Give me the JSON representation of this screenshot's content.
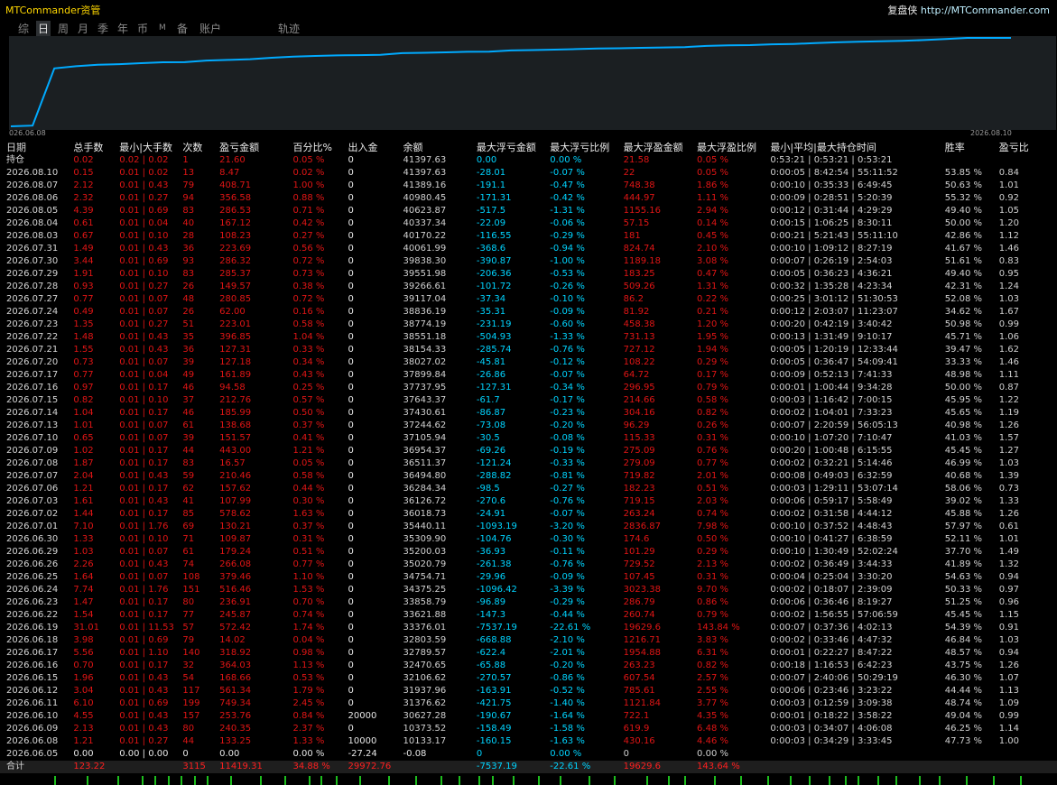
{
  "header": {
    "app_title": "MTCommander资管",
    "link_label": "复盘侠",
    "link_url": "http://MTCommander.com"
  },
  "tabs": [
    "综",
    "日",
    "周",
    "月",
    "季",
    "年",
    "币",
    "M",
    "备",
    "账户",
    "轨迹"
  ],
  "active_tab": "日",
  "chart_data": {
    "type": "line",
    "x_start_label": "026.06.08",
    "x_end_label": "2026.08.10",
    "series_color": "#00aaff",
    "grid": false,
    "y": [
      -27.24,
      10133.17,
      10373.52,
      30627.28,
      31376.62,
      31937.96,
      32106.62,
      32470.65,
      32789.57,
      32803.59,
      33376.01,
      33621.88,
      33858.79,
      34375.25,
      34754.71,
      35020.79,
      35200.03,
      35309.9,
      35440.11,
      36018.73,
      36126.72,
      36284.34,
      36494.8,
      36511.37,
      36954.37,
      37105.94,
      37244.62,
      37430.61,
      37643.37,
      37737.95,
      37899.84,
      38027.02,
      38154.33,
      38551.18,
      38774.19,
      38836.19,
      39117.04,
      39266.61,
      39551.98,
      39838.3,
      40061.99,
      40170.22,
      40337.34,
      40623.87,
      40980.45,
      41389.16,
      41397.63,
      41397.63
    ]
  },
  "columns": [
    "日期",
    "总手数",
    "最小|大手数",
    "次数",
    "盈亏金额",
    "百分比%",
    "出入金",
    "余额",
    "最大浮亏金额",
    "最大浮亏比例",
    "最大浮盈金额",
    "最大浮盈比例",
    "最小|平均|最大持仓时间",
    "胜率",
    "盈亏比"
  ],
  "rows": [
    [
      "持仓",
      "0.02",
      "0.02 | 0.02",
      "1",
      "21.60",
      "0.05 %",
      "0",
      "41397.63",
      "0.00",
      "0.00 %",
      "21.58",
      "0.05 %",
      "0:53:21 | 0:53:21 | 0:53:21",
      "",
      ""
    ],
    [
      "2026.08.10",
      "0.15",
      "0.01 | 0.02",
      "13",
      "8.47",
      "0.02 %",
      "0",
      "41397.63",
      "-28.01",
      "-0.07 %",
      "22",
      "0.05 %",
      "0:00:05 | 8:42:54 | 55:11:52",
      "53.85 %",
      "0.84"
    ],
    [
      "2026.08.07",
      "2.12",
      "0.01 | 0.43",
      "79",
      "408.71",
      "1.00 %",
      "0",
      "41389.16",
      "-191.1",
      "-0.47 %",
      "748.38",
      "1.86 %",
      "0:00:10 | 0:35:33 | 6:49:45",
      "50.63 %",
      "1.01"
    ],
    [
      "2026.08.06",
      "2.32",
      "0.01 | 0.27",
      "94",
      "356.58",
      "0.88 %",
      "0",
      "40980.45",
      "-171.31",
      "-0.42 %",
      "444.97",
      "1.11 %",
      "0:00:09 | 0:28:51 | 5:20:39",
      "55.32 %",
      "0.92"
    ],
    [
      "2026.08.05",
      "4.39",
      "0.01 | 0.69",
      "83",
      "286.53",
      "0.71 %",
      "0",
      "40623.87",
      "-517.5",
      "-1.31 %",
      "1155.16",
      "2.94 %",
      "0:00:12 | 0:31:44 | 4:29:29",
      "49.40 %",
      "1.05"
    ],
    [
      "2026.08.04",
      "0.61",
      "0.01 | 0.04",
      "40",
      "167.12",
      "0.42 %",
      "0",
      "40337.34",
      "-22.09",
      "-0.06 %",
      "57.15",
      "0.14 %",
      "0:00:15 | 1:06:25 | 8:30:11",
      "50.00 %",
      "1.20"
    ],
    [
      "2026.08.03",
      "0.67",
      "0.01 | 0.10",
      "28",
      "108.23",
      "0.27 %",
      "0",
      "40170.22",
      "-116.55",
      "-0.29 %",
      "181",
      "0.45 %",
      "0:00:21 | 5:21:43 | 55:11:10",
      "42.86 %",
      "1.12"
    ],
    [
      "2026.07.31",
      "1.49",
      "0.01 | 0.43",
      "36",
      "223.69",
      "0.56 %",
      "0",
      "40061.99",
      "-368.6",
      "-0.94 %",
      "824.74",
      "2.10 %",
      "0:00:10 | 1:09:12 | 8:27:19",
      "41.67 %",
      "1.46"
    ],
    [
      "2026.07.30",
      "3.44",
      "0.01 | 0.69",
      "93",
      "286.32",
      "0.72 %",
      "0",
      "39838.30",
      "-390.87",
      "-1.00 %",
      "1189.18",
      "3.08 %",
      "0:00:07 | 0:26:19 | 2:54:03",
      "51.61 %",
      "0.83"
    ],
    [
      "2026.07.29",
      "1.91",
      "0.01 | 0.10",
      "83",
      "285.37",
      "0.73 %",
      "0",
      "39551.98",
      "-206.36",
      "-0.53 %",
      "183.25",
      "0.47 %",
      "0:00:05 | 0:36:23 | 4:36:21",
      "49.40 %",
      "0.95"
    ],
    [
      "2026.07.28",
      "0.93",
      "0.01 | 0.27",
      "26",
      "149.57",
      "0.38 %",
      "0",
      "39266.61",
      "-101.72",
      "-0.26 %",
      "509.26",
      "1.31 %",
      "0:00:32 | 1:35:28 | 4:23:34",
      "42.31 %",
      "1.24"
    ],
    [
      "2026.07.27",
      "0.77",
      "0.01 | 0.07",
      "48",
      "280.85",
      "0.72 %",
      "0",
      "39117.04",
      "-37.34",
      "-0.10 %",
      "86.2",
      "0.22 %",
      "0:00:25 | 3:01:12 | 51:30:53",
      "52.08 %",
      "1.03"
    ],
    [
      "2026.07.24",
      "0.49",
      "0.01 | 0.07",
      "26",
      "62.00",
      "0.16 %",
      "0",
      "38836.19",
      "-35.31",
      "-0.09 %",
      "81.92",
      "0.21 %",
      "0:00:12 | 2:03:07 | 11:23:07",
      "34.62 %",
      "1.67"
    ],
    [
      "2026.07.23",
      "1.35",
      "0.01 | 0.27",
      "51",
      "223.01",
      "0.58 %",
      "0",
      "38774.19",
      "-231.19",
      "-0.60 %",
      "458.38",
      "1.20 %",
      "0:00:20 | 0:42:19 | 3:40:42",
      "50.98 %",
      "0.99"
    ],
    [
      "2026.07.22",
      "1.48",
      "0.01 | 0.43",
      "35",
      "396.85",
      "1.04 %",
      "0",
      "38551.18",
      "-504.93",
      "-1.33 %",
      "731.13",
      "1.95 %",
      "0:00:13 | 1:31:49 | 9:10:17",
      "45.71 %",
      "1.06"
    ],
    [
      "2026.07.21",
      "1.55",
      "0.01 | 0.43",
      "36",
      "127.31",
      "0.33 %",
      "0",
      "38154.33",
      "-285.74",
      "-0.76 %",
      "727.12",
      "1.94 %",
      "0:00:05 | 1:20:19 | 12:33:44",
      "39.47 %",
      "1.62"
    ],
    [
      "2026.07.20",
      "0.73",
      "0.01 | 0.07",
      "39",
      "127.18",
      "0.34 %",
      "0",
      "38027.02",
      "-45.81",
      "-0.12 %",
      "108.22",
      "0.29 %",
      "0:00:05 | 0:36:47 | 54:09:41",
      "33.33 %",
      "1.46"
    ],
    [
      "2026.07.17",
      "0.77",
      "0.01 | 0.04",
      "49",
      "161.89",
      "0.43 %",
      "0",
      "37899.84",
      "-26.86",
      "-0.07 %",
      "64.72",
      "0.17 %",
      "0:00:09 | 0:52:13 | 7:41:33",
      "48.98 %",
      "1.11"
    ],
    [
      "2026.07.16",
      "0.97",
      "0.01 | 0.17",
      "46",
      "94.58",
      "0.25 %",
      "0",
      "37737.95",
      "-127.31",
      "-0.34 %",
      "296.95",
      "0.79 %",
      "0:00:01 | 1:00:44 | 9:34:28",
      "50.00 %",
      "0.87"
    ],
    [
      "2026.07.15",
      "0.82",
      "0.01 | 0.10",
      "37",
      "212.76",
      "0.57 %",
      "0",
      "37643.37",
      "-61.7",
      "-0.17 %",
      "214.66",
      "0.58 %",
      "0:00:03 | 1:16:42 | 7:00:15",
      "45.95 %",
      "1.22"
    ],
    [
      "2026.07.14",
      "1.04",
      "0.01 | 0.17",
      "46",
      "185.99",
      "0.50 %",
      "0",
      "37430.61",
      "-86.87",
      "-0.23 %",
      "304.16",
      "0.82 %",
      "0:00:02 | 1:04:01 | 7:33:23",
      "45.65 %",
      "1.19"
    ],
    [
      "2026.07.13",
      "1.01",
      "0.01 | 0.07",
      "61",
      "138.68",
      "0.37 %",
      "0",
      "37244.62",
      "-73.08",
      "-0.20 %",
      "96.29",
      "0.26 %",
      "0:00:07 | 2:20:59 | 56:05:13",
      "40.98 %",
      "1.26"
    ],
    [
      "2026.07.10",
      "0.65",
      "0.01 | 0.07",
      "39",
      "151.57",
      "0.41 %",
      "0",
      "37105.94",
      "-30.5",
      "-0.08 %",
      "115.33",
      "0.31 %",
      "0:00:10 | 1:07:20 | 7:10:47",
      "41.03 %",
      "1.57"
    ],
    [
      "2026.07.09",
      "1.02",
      "0.01 | 0.17",
      "44",
      "443.00",
      "1.21 %",
      "0",
      "36954.37",
      "-69.26",
      "-0.19 %",
      "275.09",
      "0.76 %",
      "0:00:20 | 1:00:48 | 6:15:55",
      "45.45 %",
      "1.27"
    ],
    [
      "2026.07.08",
      "1.87",
      "0.01 | 0.17",
      "83",
      "16.57",
      "0.05 %",
      "0",
      "36511.37",
      "-121.24",
      "-0.33 %",
      "279.09",
      "0.77 %",
      "0:00:02 | 0:32:21 | 5:14:46",
      "46.99 %",
      "1.03"
    ],
    [
      "2026.07.07",
      "2.04",
      "0.01 | 0.43",
      "59",
      "210.46",
      "0.58 %",
      "0",
      "36494.80",
      "-288.82",
      "-0.81 %",
      "719.82",
      "2.01 %",
      "0:00:08 | 0:49:03 | 6:32:59",
      "40.68 %",
      "1.39"
    ],
    [
      "2026.07.06",
      "1.21",
      "0.01 | 0.17",
      "62",
      "157.62",
      "0.44 %",
      "0",
      "36284.34",
      "-98.5",
      "-0.27 %",
      "182.23",
      "0.51 %",
      "0:00:03 | 1:29:11 | 53:07:14",
      "58.06 %",
      "0.73"
    ],
    [
      "2026.07.03",
      "1.61",
      "0.01 | 0.43",
      "41",
      "107.99",
      "0.30 %",
      "0",
      "36126.72",
      "-270.6",
      "-0.76 %",
      "719.15",
      "2.03 %",
      "0:00:06 | 0:59:17 | 5:58:49",
      "39.02 %",
      "1.33"
    ],
    [
      "2026.07.02",
      "1.44",
      "0.01 | 0.17",
      "85",
      "578.62",
      "1.63 %",
      "0",
      "36018.73",
      "-24.91",
      "-0.07 %",
      "263.24",
      "0.74 %",
      "0:00:02 | 0:31:58 | 4:44:12",
      "45.88 %",
      "1.26"
    ],
    [
      "2026.07.01",
      "7.10",
      "0.01 | 1.76",
      "69",
      "130.21",
      "0.37 %",
      "0",
      "35440.11",
      "-1093.19",
      "-3.20 %",
      "2836.87",
      "7.98 %",
      "0:00:10 | 0:37:52 | 4:48:43",
      "57.97 %",
      "0.61"
    ],
    [
      "2026.06.30",
      "1.33",
      "0.01 | 0.10",
      "71",
      "109.87",
      "0.31 %",
      "0",
      "35309.90",
      "-104.76",
      "-0.30 %",
      "174.6",
      "0.50 %",
      "0:00:10 | 0:41:27 | 6:38:59",
      "52.11 %",
      "1.01"
    ],
    [
      "2026.06.29",
      "1.03",
      "0.01 | 0.07",
      "61",
      "179.24",
      "0.51 %",
      "0",
      "35200.03",
      "-36.93",
      "-0.11 %",
      "101.29",
      "0.29 %",
      "0:00:10 | 1:30:49 | 52:02:24",
      "37.70 %",
      "1.49"
    ],
    [
      "2026.06.26",
      "2.26",
      "0.01 | 0.43",
      "74",
      "266.08",
      "0.77 %",
      "0",
      "35020.79",
      "-261.38",
      "-0.76 %",
      "729.52",
      "2.13 %",
      "0:00:02 | 0:36:49 | 3:44:33",
      "41.89 %",
      "1.32"
    ],
    [
      "2026.06.25",
      "1.64",
      "0.01 | 0.07",
      "108",
      "379.46",
      "1.10 %",
      "0",
      "34754.71",
      "-29.96",
      "-0.09 %",
      "107.45",
      "0.31 %",
      "0:00:04 | 0:25:04 | 3:30:20",
      "54.63 %",
      "0.94"
    ],
    [
      "2026.06.24",
      "7.74",
      "0.01 | 1.76",
      "151",
      "516.46",
      "1.53 %",
      "0",
      "34375.25",
      "-1096.42",
      "-3.39 %",
      "3023.38",
      "9.70 %",
      "0:00:02 | 0:18:07 | 2:39:09",
      "50.33 %",
      "0.97"
    ],
    [
      "2026.06.23",
      "1.47",
      "0.01 | 0.17",
      "80",
      "236.91",
      "0.70 %",
      "0",
      "33858.79",
      "-96.89",
      "-0.29 %",
      "286.79",
      "0.86 %",
      "0:00:06 | 0:36:46 | 8:19:27",
      "51.25 %",
      "0.96"
    ],
    [
      "2026.06.22",
      "1.54",
      "0.01 | 0.17",
      "77",
      "245.87",
      "0.74 %",
      "0",
      "33621.88",
      "-147.3",
      "-0.44 %",
      "260.74",
      "0.79 %",
      "0:00:02 | 1:56:55 | 57:06:59",
      "45.45 %",
      "1.15"
    ],
    [
      "2026.06.19",
      "31.01",
      "0.01 | 11.53",
      "57",
      "572.42",
      "1.74 %",
      "0",
      "33376.01",
      "-7537.19",
      "-22.61 %",
      "19629.6",
      "143.84 %",
      "0:00:07 | 0:37:36 | 4:02:13",
      "54.39 %",
      "0.91"
    ],
    [
      "2026.06.18",
      "3.98",
      "0.01 | 0.69",
      "79",
      "14.02",
      "0.04 %",
      "0",
      "32803.59",
      "-668.88",
      "-2.10 %",
      "1216.71",
      "3.83 %",
      "0:00:02 | 0:33:46 | 4:47:32",
      "46.84 %",
      "1.03"
    ],
    [
      "2026.06.17",
      "5.56",
      "0.01 | 1.10",
      "140",
      "318.92",
      "0.98 %",
      "0",
      "32789.57",
      "-622.4",
      "-2.01 %",
      "1954.88",
      "6.31 %",
      "0:00:01 | 0:22:27 | 8:47:22",
      "48.57 %",
      "0.94"
    ],
    [
      "2026.06.16",
      "0.70",
      "0.01 | 0.17",
      "32",
      "364.03",
      "1.13 %",
      "0",
      "32470.65",
      "-65.88",
      "-0.20 %",
      "263.23",
      "0.82 %",
      "0:00:18 | 1:16:53 | 6:42:23",
      "43.75 %",
      "1.26"
    ],
    [
      "2026.06.15",
      "1.96",
      "0.01 | 0.43",
      "54",
      "168.66",
      "0.53 %",
      "0",
      "32106.62",
      "-270.57",
      "-0.86 %",
      "607.54",
      "2.57 %",
      "0:00:07 | 2:40:06 | 50:29:19",
      "46.30 %",
      "1.07"
    ],
    [
      "2026.06.12",
      "3.04",
      "0.01 | 0.43",
      "117",
      "561.34",
      "1.79 %",
      "0",
      "31937.96",
      "-163.91",
      "-0.52 %",
      "785.61",
      "2.55 %",
      "0:00:06 | 0:23:46 | 3:23:22",
      "44.44 %",
      "1.13"
    ],
    [
      "2026.06.11",
      "6.10",
      "0.01 | 0.69",
      "199",
      "749.34",
      "2.45 %",
      "0",
      "31376.62",
      "-421.75",
      "-1.40 %",
      "1121.84",
      "3.77 %",
      "0:00:03 | 0:12:59 | 3:09:38",
      "48.74 %",
      "1.09"
    ],
    [
      "2026.06.10",
      "4.55",
      "0.01 | 0.43",
      "157",
      "253.76",
      "0.84 %",
      "20000",
      "30627.28",
      "-190.67",
      "-1.64 %",
      "722.1",
      "4.35 %",
      "0:00:01 | 0:18:22 | 3:58:22",
      "49.04 %",
      "0.99"
    ],
    [
      "2026.06.09",
      "2.13",
      "0.01 | 0.43",
      "80",
      "240.35",
      "2.37 %",
      "0",
      "10373.52",
      "-158.49",
      "-1.58 %",
      "619.9",
      "6.48 %",
      "0:00:03 | 0:34:07 | 4:06:08",
      "46.25 %",
      "1.14"
    ],
    [
      "2026.06.08",
      "1.21",
      "0.01 | 0.27",
      "44",
      "133.25",
      "1.33 %",
      "10000",
      "10133.17",
      "-160.15",
      "-1.63 %",
      "430.16",
      "4.46 %",
      "0:00:03 | 0:34:29 | 3:33:45",
      "47.73 %",
      "1.00"
    ],
    [
      "2026.06.05",
      "0.00",
      "0.00 | 0.00",
      "0",
      "0.00",
      "0.00 %",
      "-27.24",
      "-0.08",
      "0",
      "0.00 %",
      "0",
      "0.00 %",
      "",
      "",
      ""
    ]
  ],
  "total": [
    "合计",
    "123.22",
    "",
    "3115",
    "11419.31",
    "34.88 %",
    "29972.76",
    "",
    "-7537.19",
    "-22.61 %",
    "19629.6",
    "143.64 %",
    "",
    "",
    ""
  ]
}
